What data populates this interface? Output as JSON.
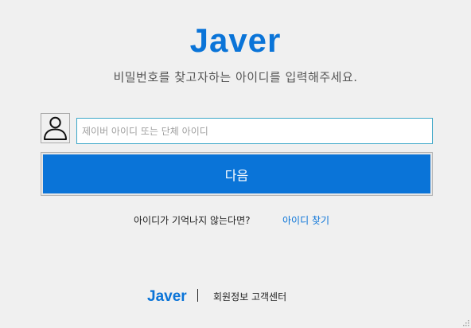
{
  "header": {
    "logo": "Javer",
    "subtitle": "비밀번호를 찾고자하는 아이디를 입력해주세요."
  },
  "form": {
    "avatar_icon": "user-icon",
    "id_input": {
      "value": "",
      "placeholder": "제이버 아이디 또는 단체 아이디"
    },
    "next_label": "다음"
  },
  "help": {
    "question": "아이디가 기억나지 않는다면?",
    "find_link": "아이디 찾기"
  },
  "footer": {
    "logo": "Javer",
    "link": "회원정보 고객센터"
  },
  "colors": {
    "accent": "#0a74d8",
    "background": "#f0f0f0",
    "input_border": "#3ca7c8"
  }
}
